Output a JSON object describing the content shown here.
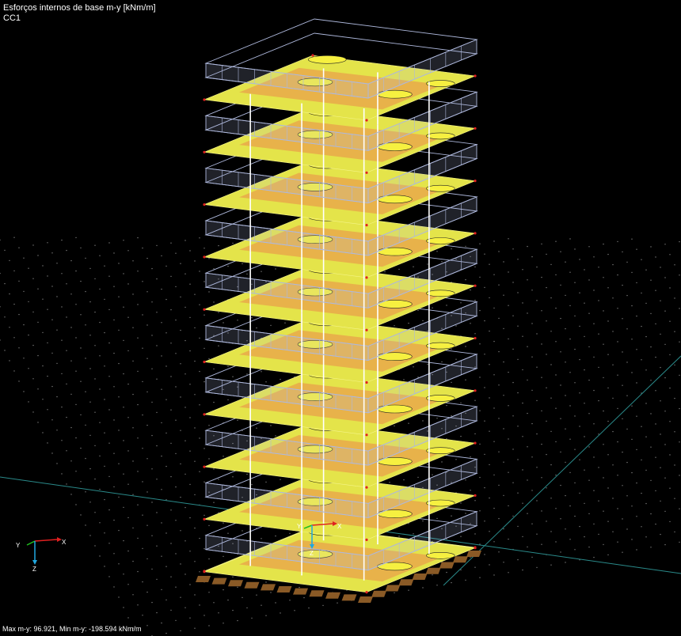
{
  "view": {
    "result_title": "Esforços internos de base m-y [kNm/m]",
    "load_case": "CC1",
    "status": "Max m-y: 96.921, Min m-y: -198.594 kNm/m"
  },
  "axes": {
    "x": "X",
    "y": "Y",
    "z": "Z"
  },
  "model": {
    "storeys": 10,
    "columns_per_slab": 6
  },
  "colors": {
    "background": "#000000",
    "slab_yellow": "#e4e44a",
    "slab_orange": "#e9a94a",
    "load_frame": "#aeb8dc",
    "column": "#ffffff",
    "support": "#8a5a26",
    "grid_line": "#2a8a8a",
    "axis_x": "#e02020",
    "axis_y": "#20c020",
    "axis_z": "#20a8e0"
  }
}
